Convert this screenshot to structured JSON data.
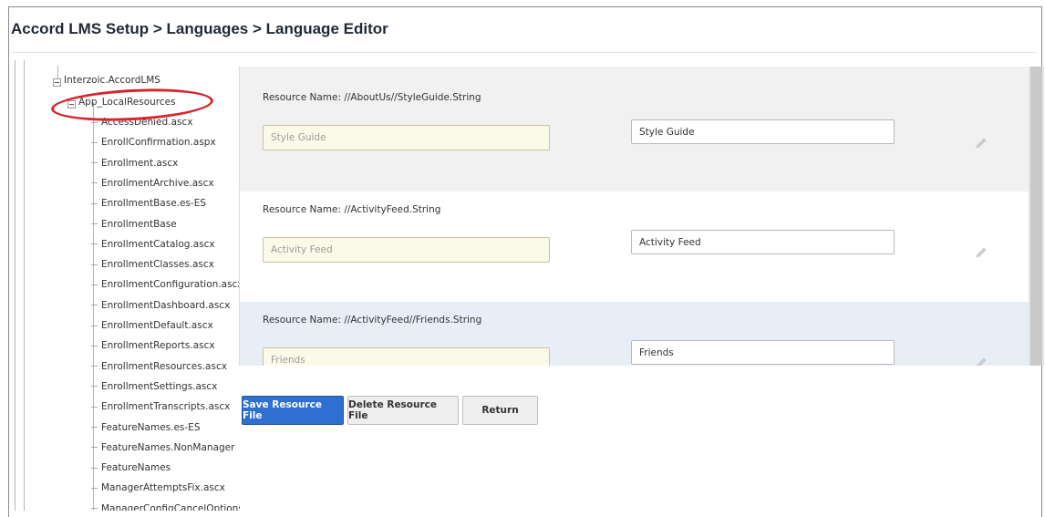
{
  "page": {
    "title": "Accord LMS Setup > Languages > Language Editor"
  },
  "tree": {
    "root": "Interzoic.AccordLMS",
    "folder": "App_LocalResources",
    "items": [
      "AccessDenied.ascx",
      "EnrollConfirmation.aspx",
      "Enrollment.ascx",
      "EnrollmentArchive.ascx",
      "EnrollmentBase.es-ES",
      "EnrollmentBase",
      "EnrollmentCatalog.ascx",
      "EnrollmentClasses.ascx",
      "EnrollmentConfiguration.ascx",
      "EnrollmentDashboard.ascx",
      "EnrollmentDefault.ascx",
      "EnrollmentReports.ascx",
      "EnrollmentResources.ascx",
      "EnrollmentSettings.ascx",
      "EnrollmentTranscripts.ascx",
      "FeatureNames.es-ES",
      "FeatureNames.NonManager",
      "FeatureNames",
      "ManagerAttemptsFix.ascx",
      "ManagerConfigCancelOptions.ascx"
    ]
  },
  "resources": [
    {
      "name": "Resource Name: //AboutUs//StyleGuide.String",
      "default": "Style Guide",
      "value": "Style Guide",
      "bg": "#f1f1f1"
    },
    {
      "name": "Resource Name: //ActivityFeed.String",
      "default": "Activity Feed",
      "value": "Activity Feed",
      "bg": "#ffffff"
    },
    {
      "name": "Resource Name: //ActivityFeed//Friends.String",
      "default": "Friends",
      "value": "Friends",
      "bg": "#e7eef8"
    }
  ],
  "buttons": {
    "save": "Save Resource File",
    "delete": "Delete Resource File",
    "return": "Return"
  },
  "colors": {
    "primary": "#2e6fcf",
    "annotation": "#d8242c"
  }
}
